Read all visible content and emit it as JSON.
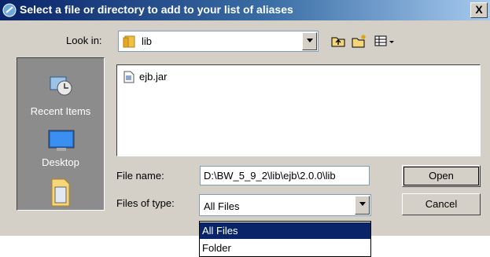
{
  "window": {
    "title": "Select a file or directory to add to your list of aliases",
    "close_glyph": "X"
  },
  "look_in": {
    "label": "Look in:",
    "value": "lib",
    "toolbar_icons": [
      "up-folder-icon",
      "new-folder-icon",
      "view-menu-icon"
    ]
  },
  "places": [
    {
      "label": "Recent Items",
      "icon": "recent-items-icon"
    },
    {
      "label": "Desktop",
      "icon": "desktop-icon"
    },
    {
      "label": "",
      "icon": "documents-icon"
    }
  ],
  "files": [
    {
      "name": "ejb.jar",
      "icon": "jar-file-icon"
    }
  ],
  "file_name": {
    "label": "File name:",
    "value": "D:\\BW_5_9_2\\lib\\ejb\\2.0.0\\lib"
  },
  "file_type": {
    "label": "Files of type:",
    "value": "All Files",
    "options": [
      "All Files",
      "Folder"
    ]
  },
  "buttons": {
    "open": "Open",
    "cancel": "Cancel"
  },
  "colors": {
    "title_start": "#0a246a",
    "title_end": "#a6caf0",
    "face": "#d4d0c8",
    "selection": "#0a246a"
  }
}
